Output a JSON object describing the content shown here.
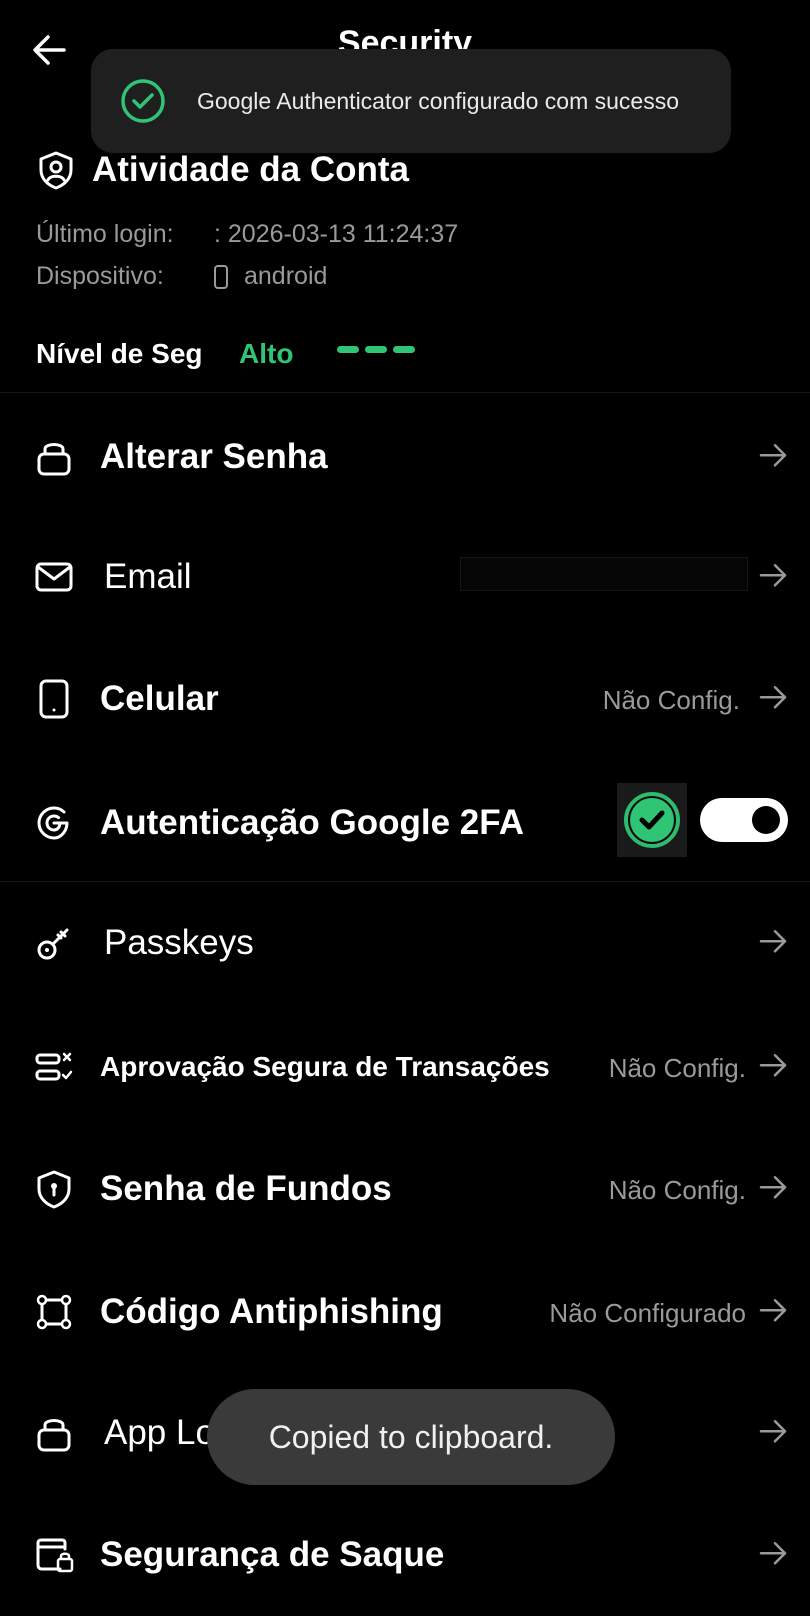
{
  "header": {
    "title": "Security",
    "back_icon": "arrow-left-icon"
  },
  "toast_top": {
    "text": "Google Authenticator configurado com sucesso",
    "icon": "check-circle-icon"
  },
  "account": {
    "title": "Atividade da Conta",
    "last_login_label": "Último login:",
    "last_login_value": ": 2026-03-13 11:24:37",
    "device_label": "Dispositivo:",
    "device_value": "android",
    "security_level_label": "Nível de Seg",
    "security_level_value": "Alto",
    "security_level_bars": 3,
    "colors": {
      "accent": "#2fc574"
    }
  },
  "settings": {
    "change_password": {
      "label": "Alterar Senha"
    },
    "email": {
      "label": "Email"
    },
    "phone": {
      "label": "Celular",
      "value": "Não Config."
    },
    "google_2fa": {
      "label": "Autenticação Google 2FA",
      "enabled": true
    },
    "passkeys": {
      "label": "Passkeys"
    },
    "secure_approval": {
      "label": "Aprovação Segura de Transações",
      "value": "Não Config."
    },
    "fund_password": {
      "label": "Senha de Fundos",
      "value": "Não Config."
    },
    "antiphishing": {
      "label": "Código Antiphishing",
      "value": "Não Configurado"
    },
    "app_lock": {
      "label": "App Lock"
    },
    "withdraw_security": {
      "label": "Segurança de Saque"
    }
  },
  "toast_bottom": {
    "text": "Copied to clipboard."
  }
}
